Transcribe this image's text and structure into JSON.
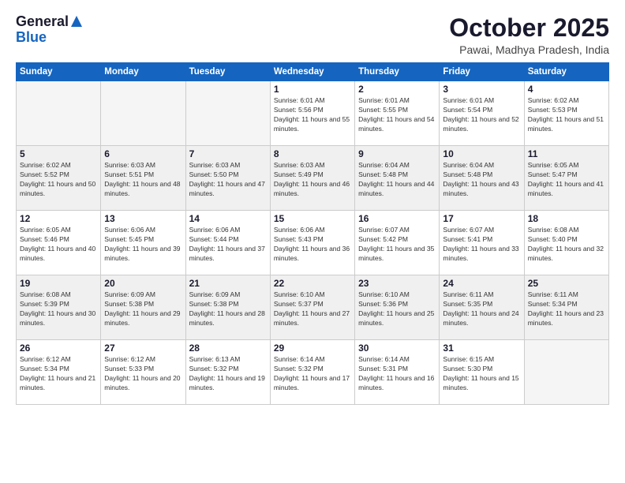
{
  "header": {
    "logo_general": "General",
    "logo_blue": "Blue",
    "title": "October 2025",
    "location": "Pawai, Madhya Pradesh, India"
  },
  "days_of_week": [
    "Sunday",
    "Monday",
    "Tuesday",
    "Wednesday",
    "Thursday",
    "Friday",
    "Saturday"
  ],
  "weeks": [
    [
      {
        "day": "",
        "empty": true
      },
      {
        "day": "",
        "empty": true
      },
      {
        "day": "",
        "empty": true
      },
      {
        "day": "1",
        "sunrise": "6:01 AM",
        "sunset": "5:56 PM",
        "daylight": "11 hours and 55 minutes."
      },
      {
        "day": "2",
        "sunrise": "6:01 AM",
        "sunset": "5:55 PM",
        "daylight": "11 hours and 54 minutes."
      },
      {
        "day": "3",
        "sunrise": "6:01 AM",
        "sunset": "5:54 PM",
        "daylight": "11 hours and 52 minutes."
      },
      {
        "day": "4",
        "sunrise": "6:02 AM",
        "sunset": "5:53 PM",
        "daylight": "11 hours and 51 minutes."
      }
    ],
    [
      {
        "day": "5",
        "sunrise": "6:02 AM",
        "sunset": "5:52 PM",
        "daylight": "11 hours and 50 minutes."
      },
      {
        "day": "6",
        "sunrise": "6:03 AM",
        "sunset": "5:51 PM",
        "daylight": "11 hours and 48 minutes."
      },
      {
        "day": "7",
        "sunrise": "6:03 AM",
        "sunset": "5:50 PM",
        "daylight": "11 hours and 47 minutes."
      },
      {
        "day": "8",
        "sunrise": "6:03 AM",
        "sunset": "5:49 PM",
        "daylight": "11 hours and 46 minutes."
      },
      {
        "day": "9",
        "sunrise": "6:04 AM",
        "sunset": "5:48 PM",
        "daylight": "11 hours and 44 minutes."
      },
      {
        "day": "10",
        "sunrise": "6:04 AM",
        "sunset": "5:48 PM",
        "daylight": "11 hours and 43 minutes."
      },
      {
        "day": "11",
        "sunrise": "6:05 AM",
        "sunset": "5:47 PM",
        "daylight": "11 hours and 41 minutes."
      }
    ],
    [
      {
        "day": "12",
        "sunrise": "6:05 AM",
        "sunset": "5:46 PM",
        "daylight": "11 hours and 40 minutes."
      },
      {
        "day": "13",
        "sunrise": "6:06 AM",
        "sunset": "5:45 PM",
        "daylight": "11 hours and 39 minutes."
      },
      {
        "day": "14",
        "sunrise": "6:06 AM",
        "sunset": "5:44 PM",
        "daylight": "11 hours and 37 minutes."
      },
      {
        "day": "15",
        "sunrise": "6:06 AM",
        "sunset": "5:43 PM",
        "daylight": "11 hours and 36 minutes."
      },
      {
        "day": "16",
        "sunrise": "6:07 AM",
        "sunset": "5:42 PM",
        "daylight": "11 hours and 35 minutes."
      },
      {
        "day": "17",
        "sunrise": "6:07 AM",
        "sunset": "5:41 PM",
        "daylight": "11 hours and 33 minutes."
      },
      {
        "day": "18",
        "sunrise": "6:08 AM",
        "sunset": "5:40 PM",
        "daylight": "11 hours and 32 minutes."
      }
    ],
    [
      {
        "day": "19",
        "sunrise": "6:08 AM",
        "sunset": "5:39 PM",
        "daylight": "11 hours and 30 minutes."
      },
      {
        "day": "20",
        "sunrise": "6:09 AM",
        "sunset": "5:38 PM",
        "daylight": "11 hours and 29 minutes."
      },
      {
        "day": "21",
        "sunrise": "6:09 AM",
        "sunset": "5:38 PM",
        "daylight": "11 hours and 28 minutes."
      },
      {
        "day": "22",
        "sunrise": "6:10 AM",
        "sunset": "5:37 PM",
        "daylight": "11 hours and 27 minutes."
      },
      {
        "day": "23",
        "sunrise": "6:10 AM",
        "sunset": "5:36 PM",
        "daylight": "11 hours and 25 minutes."
      },
      {
        "day": "24",
        "sunrise": "6:11 AM",
        "sunset": "5:35 PM",
        "daylight": "11 hours and 24 minutes."
      },
      {
        "day": "25",
        "sunrise": "6:11 AM",
        "sunset": "5:34 PM",
        "daylight": "11 hours and 23 minutes."
      }
    ],
    [
      {
        "day": "26",
        "sunrise": "6:12 AM",
        "sunset": "5:34 PM",
        "daylight": "11 hours and 21 minutes."
      },
      {
        "day": "27",
        "sunrise": "6:12 AM",
        "sunset": "5:33 PM",
        "daylight": "11 hours and 20 minutes."
      },
      {
        "day": "28",
        "sunrise": "6:13 AM",
        "sunset": "5:32 PM",
        "daylight": "11 hours and 19 minutes."
      },
      {
        "day": "29",
        "sunrise": "6:14 AM",
        "sunset": "5:32 PM",
        "daylight": "11 hours and 17 minutes."
      },
      {
        "day": "30",
        "sunrise": "6:14 AM",
        "sunset": "5:31 PM",
        "daylight": "11 hours and 16 minutes."
      },
      {
        "day": "31",
        "sunrise": "6:15 AM",
        "sunset": "5:30 PM",
        "daylight": "11 hours and 15 minutes."
      },
      {
        "day": "",
        "empty": true
      }
    ]
  ]
}
